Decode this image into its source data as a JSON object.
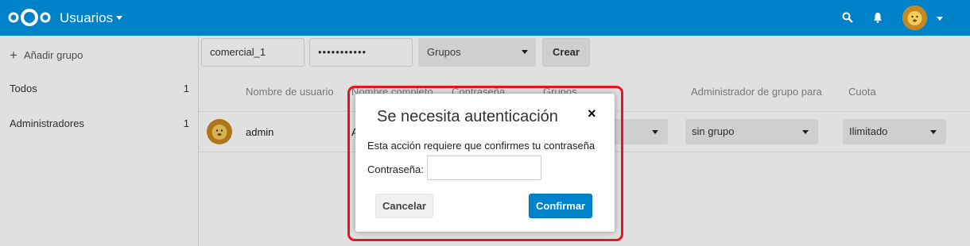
{
  "header": {
    "app_title": "Usuarios",
    "icons": [
      "nextcloud-logo",
      "search-icon",
      "bell-icon",
      "avatar"
    ]
  },
  "sidebar": {
    "add_group": "Añadir grupo",
    "items": [
      {
        "label": "Todos",
        "count": "1"
      },
      {
        "label": "Administradores",
        "count": "1"
      }
    ]
  },
  "new_user": {
    "username_value": "comercial_1",
    "password_value": "•••••••••••",
    "groups_placeholder": "Grupos",
    "create_label": "Crear"
  },
  "table": {
    "columns": [
      "Nombre de usuario",
      "Nombre completo",
      "Contraseña",
      "Grupos",
      "Administrador de grupo para",
      "Cuota"
    ],
    "rows": [
      {
        "username": "admin",
        "fullname": "A",
        "subadmin": "sin grupo",
        "quota": "Ilimitado"
      }
    ]
  },
  "dialog": {
    "title": "Se necesita autenticación",
    "close": "×",
    "message": "Esta acción requiere que confirmes tu contraseña",
    "password_label": "Contraseña:",
    "cancel_label": "Cancelar",
    "confirm_label": "Confirmar"
  },
  "colors": {
    "brand": "#0082c9",
    "highlight": "#e8141e"
  }
}
